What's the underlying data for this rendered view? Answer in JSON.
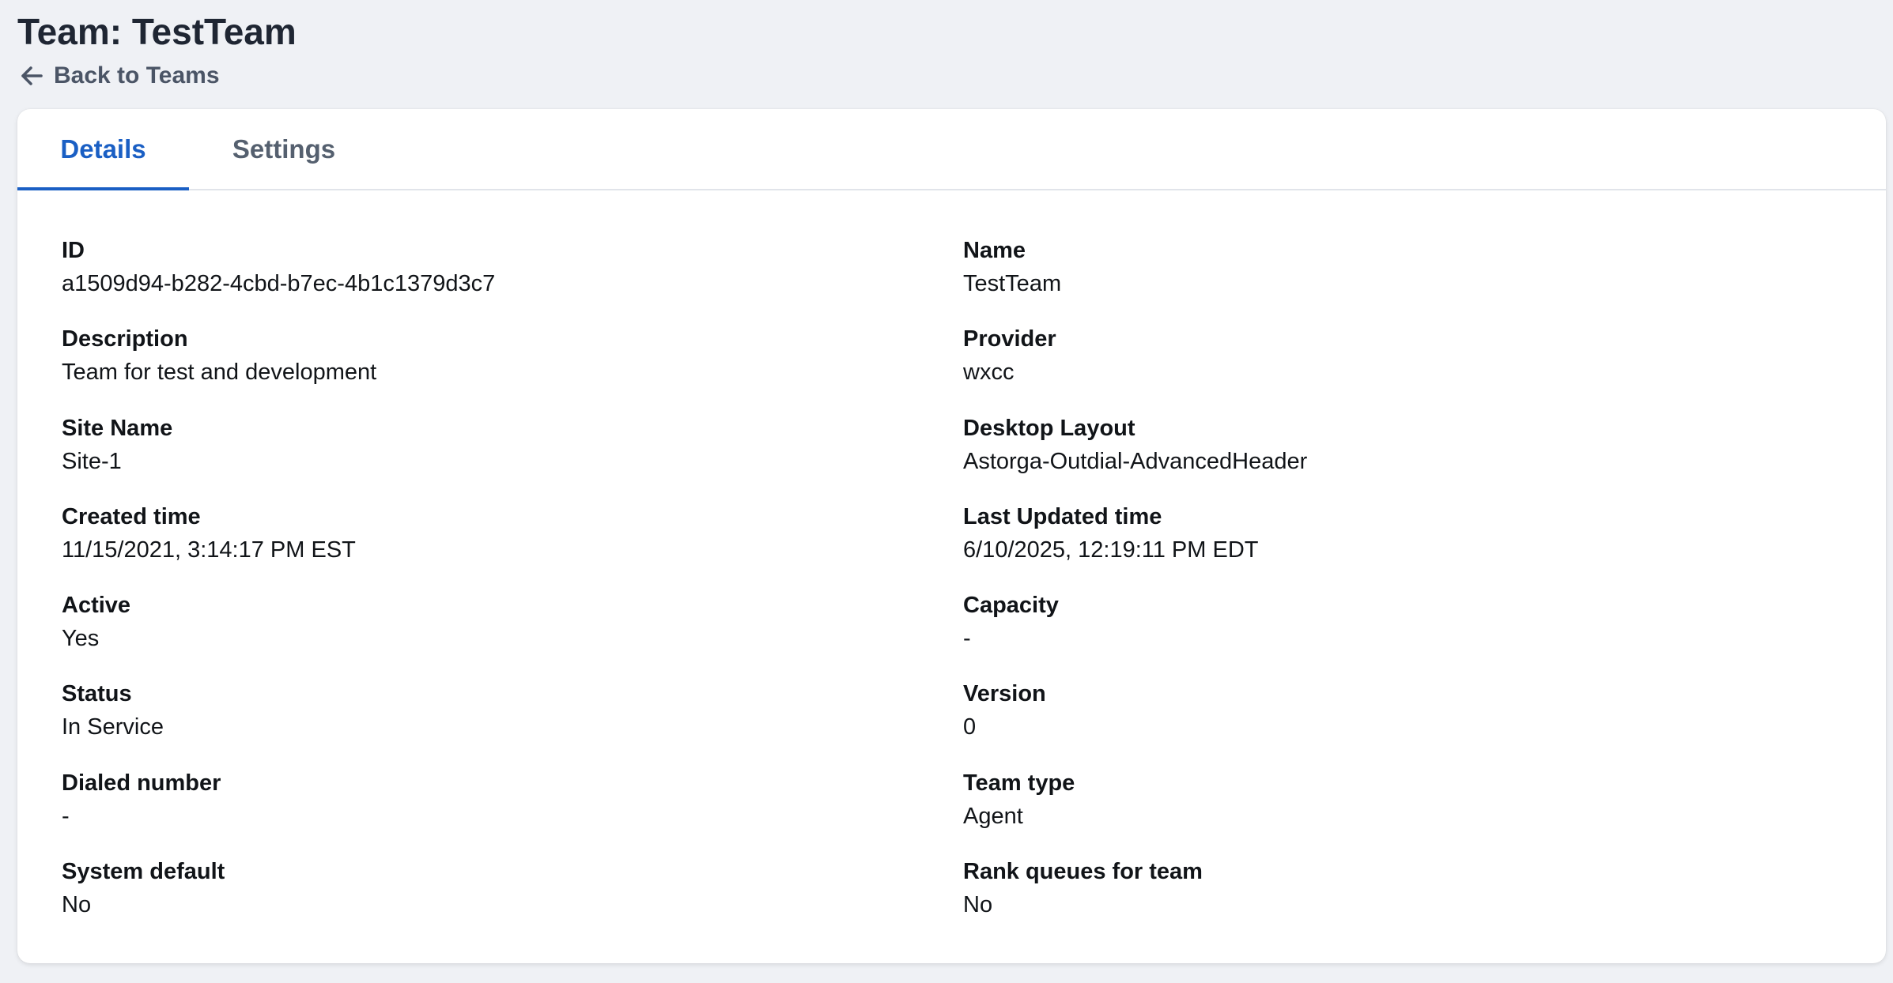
{
  "header": {
    "title": "Team: TestTeam",
    "back_label": "Back to Teams"
  },
  "tabs": [
    {
      "label": "Details",
      "active": true
    },
    {
      "label": "Settings",
      "active": false
    }
  ],
  "details": {
    "left": [
      {
        "label": "ID",
        "value": "a1509d94-b282-4cbd-b7ec-4b1c1379d3c7"
      },
      {
        "label": "Description",
        "value": "Team for test and development"
      },
      {
        "label": "Site Name",
        "value": "Site-1"
      },
      {
        "label": "Created time",
        "value": "11/15/2021, 3:14:17 PM EST"
      },
      {
        "label": "Active",
        "value": "Yes"
      },
      {
        "label": "Status",
        "value": "In Service"
      },
      {
        "label": "Dialed number",
        "value": "-"
      },
      {
        "label": "System default",
        "value": "No"
      }
    ],
    "right": [
      {
        "label": "Name",
        "value": "TestTeam"
      },
      {
        "label": "Provider",
        "value": "wxcc"
      },
      {
        "label": "Desktop Layout",
        "value": "Astorga-Outdial-AdvancedHeader"
      },
      {
        "label": "Last Updated time",
        "value": "6/10/2025, 12:19:11 PM EDT"
      },
      {
        "label": "Capacity",
        "value": "-"
      },
      {
        "label": "Version",
        "value": "0"
      },
      {
        "label": "Team type",
        "value": "Agent"
      },
      {
        "label": "Rank queues for team",
        "value": "No"
      }
    ]
  },
  "colors": {
    "accent": "#1a5fc4",
    "background": "#eff1f5"
  },
  "icons": {
    "back": "arrow-left-icon"
  }
}
